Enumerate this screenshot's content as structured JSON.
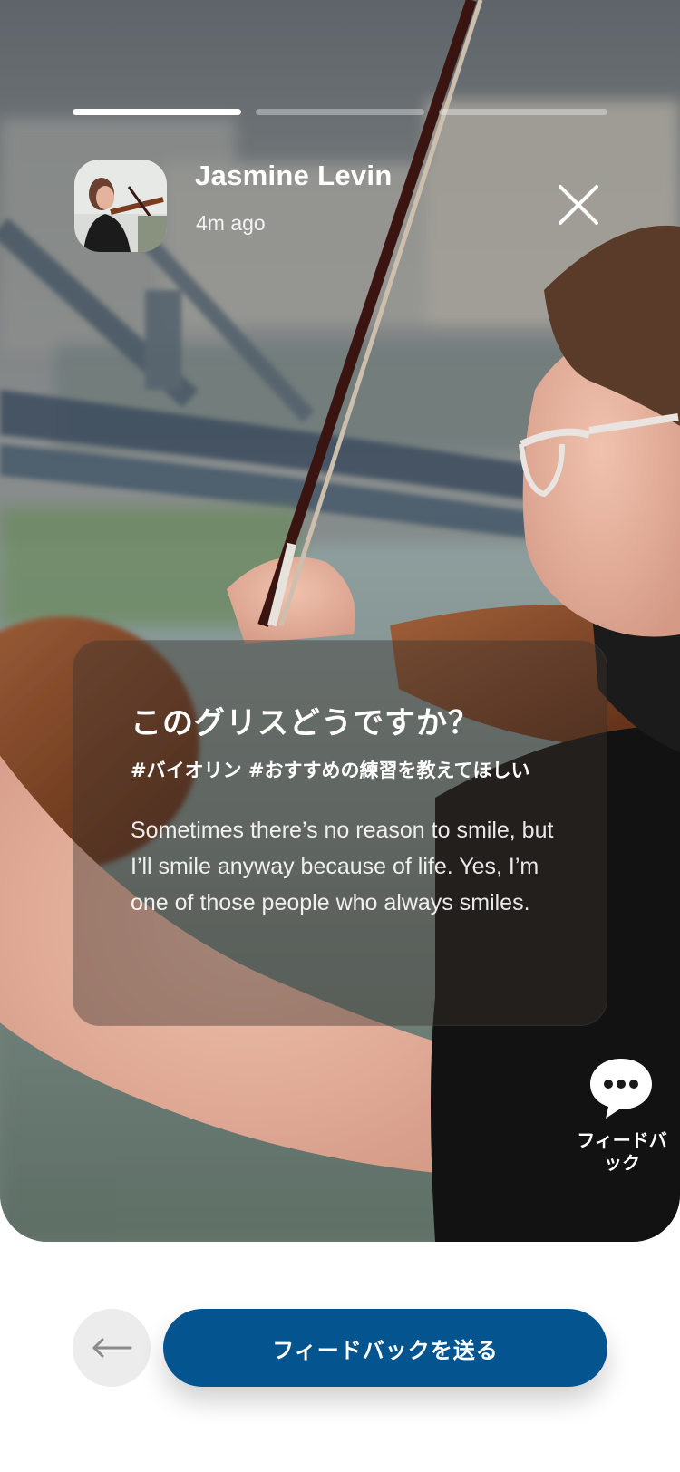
{
  "story": {
    "progress": [
      1,
      0,
      0
    ],
    "user": {
      "name": "Jasmine Levin",
      "time_ago": "4m ago",
      "avatar": "avatar"
    },
    "close_icon": "close-icon"
  },
  "card": {
    "title": "このグリスどうですか？",
    "tags": "#バイオリン #おすすめの練習を教えてほしい",
    "body": "Sometimes there’s no reason to smile, but I’ll smile anyway because of life. Yes, I’m one of those people who always smiles."
  },
  "feedback": {
    "icon": "chat-bubble-icon",
    "label": "フィードバック"
  },
  "footer": {
    "back_icon": "arrow-left-icon",
    "send_label": "フィードバックを送る"
  },
  "colors": {
    "primary": "#03548f",
    "back_bg": "#ececec"
  }
}
